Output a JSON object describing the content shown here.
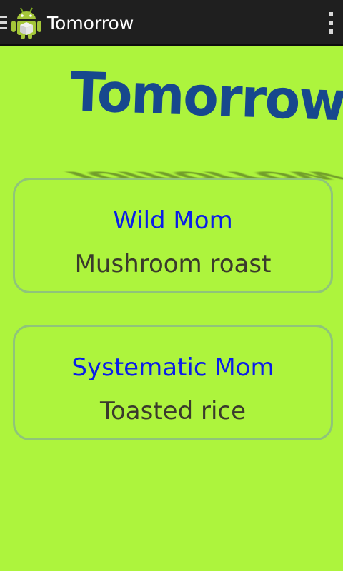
{
  "actionbar": {
    "title": "Tomorrow",
    "background": "#1f1f1f",
    "app_icon": "android-robot-icon",
    "drawer_icon": "drawer-indicator-icon",
    "overflow_icon": "overflow-menu-icon"
  },
  "logo": {
    "text": "Tomorrow",
    "color": "#17488d"
  },
  "background": "#adf43d",
  "cards": [
    {
      "name": "Wild Mom",
      "dish": "Mushroom roast"
    },
    {
      "name": "Systematic Mom",
      "dish": "Toasted rice"
    }
  ]
}
